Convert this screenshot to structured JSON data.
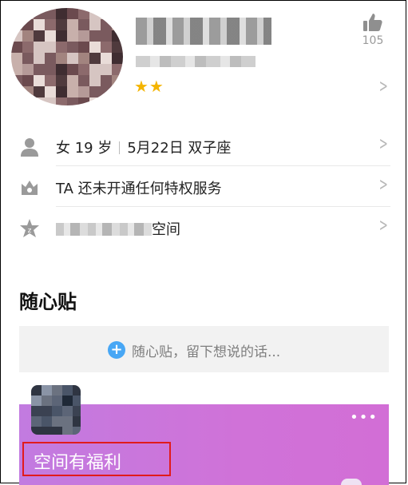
{
  "profile": {
    "like_count": "105",
    "stars": "★★",
    "icons": {
      "like": "thumbs-up-icon",
      "chevron": "chevron-right-icon"
    }
  },
  "info_rows": [
    {
      "icon": "person-icon",
      "text_parts": [
        "女 19 岁",
        "5月22日 双子座"
      ]
    },
    {
      "icon": "crown-badge-icon",
      "text": "TA 还未开通任何特权服务"
    },
    {
      "icon": "star-zone-icon",
      "text": "空间"
    }
  ],
  "section": {
    "title": "随心贴"
  },
  "post_input": {
    "placeholder": "随心贴，留下想说的话..."
  },
  "card": {
    "title": "空间有福利",
    "more": "•••"
  },
  "colors": {
    "accent_blue": "#48a7f5",
    "card_purple": "#c27be0",
    "highlight_red": "#e11b1b",
    "star_gold": "#f4b400"
  }
}
